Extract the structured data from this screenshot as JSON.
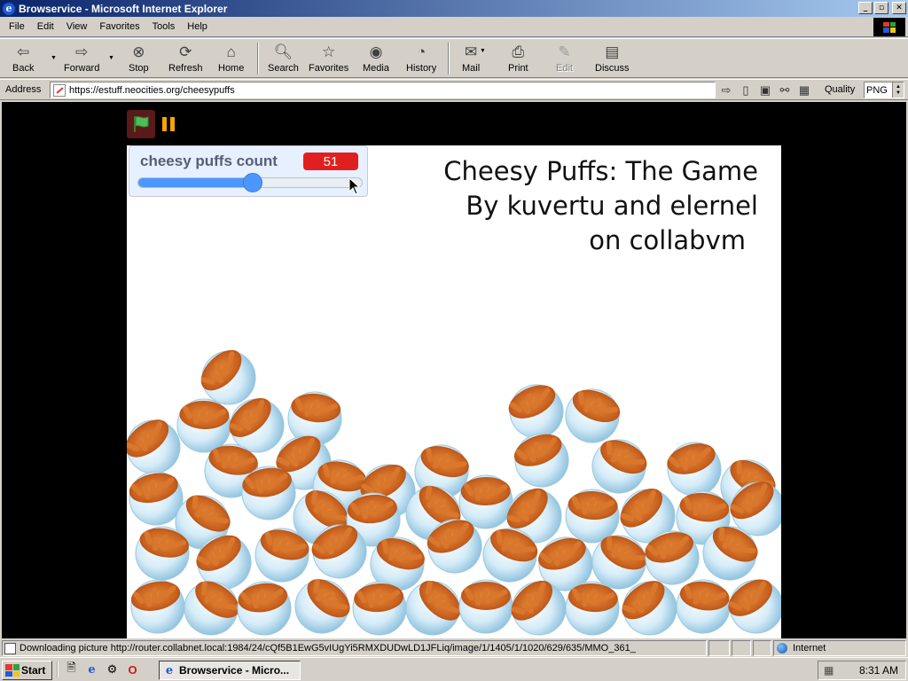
{
  "window": {
    "title": "Browservice - Microsoft Internet Explorer",
    "controls": {
      "minimize": "_",
      "maximize": "▫",
      "close": "✕"
    }
  },
  "menu": [
    "File",
    "Edit",
    "View",
    "Favorites",
    "Tools",
    "Help"
  ],
  "toolbar": {
    "back": "Back",
    "forward": "Forward",
    "stop": "Stop",
    "refresh": "Refresh",
    "home": "Home",
    "search": "Search",
    "favorites": "Favorites",
    "media": "Media",
    "history": "History",
    "mail": "Mail",
    "print": "Print",
    "edit": "Edit",
    "discuss": "Discuss"
  },
  "address": {
    "label": "Address",
    "url": "https://estuff.neocities.org/cheesypuffs",
    "quality_label": "Quality",
    "quality_value": "PNG"
  },
  "game": {
    "monitor_label": "cheesy puffs count",
    "monitor_value": "51",
    "slider_fraction": 0.51,
    "title_line1": "Cheesy Puffs: The Game",
    "title_line2": "By kuvertu and elernel",
    "title_line3": "on collabvm",
    "colors": {
      "slider": "#4c97ff",
      "value_badge": "#e02020",
      "flag_bg": "#5a1a1a",
      "pause": "#f5a400"
    }
  },
  "status": {
    "text": "Downloading picture http://router.collabnet.local:1984/24/cQf5B1EwG5vIUgYi5RMXDUDwLD1JFLiq/image/1/1405/1/1020/629/635/MMO_361_",
    "zone": "Internet"
  },
  "taskbar": {
    "start": "Start",
    "task": "Browservice - Micro...",
    "clock": "8:31 AM"
  }
}
